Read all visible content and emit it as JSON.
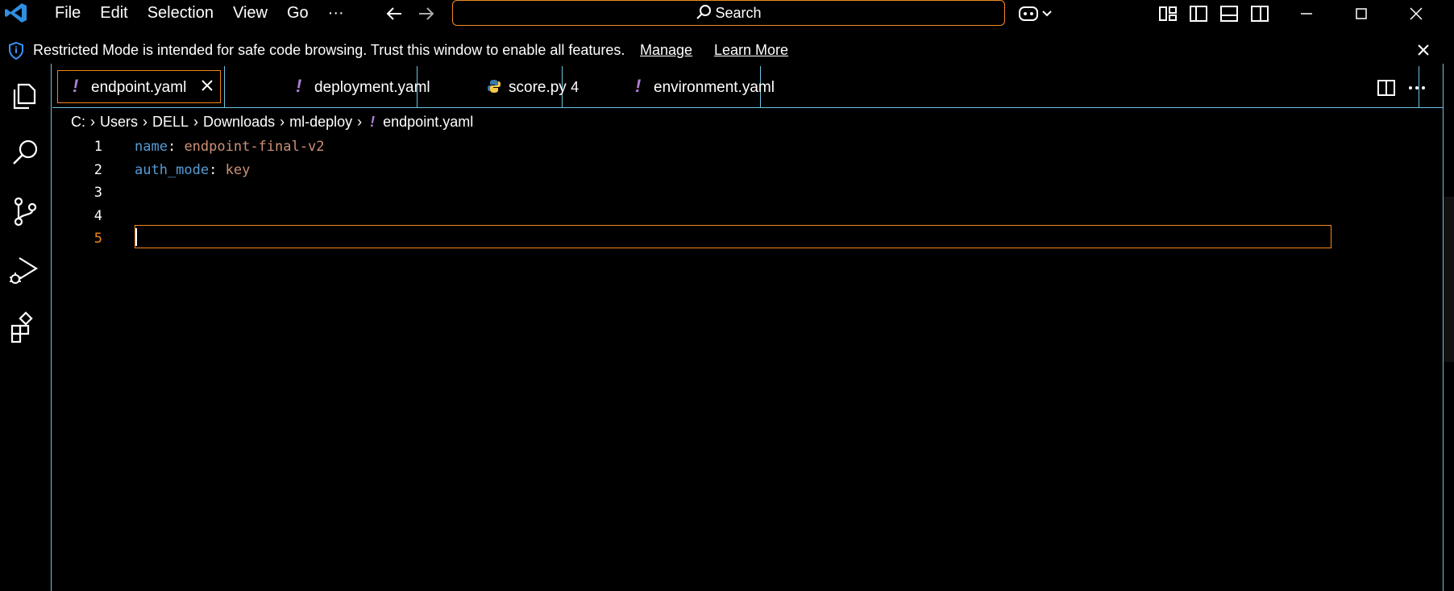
{
  "titlebar": {
    "menu": [
      "File",
      "Edit",
      "Selection",
      "View",
      "Go",
      "···"
    ],
    "search_label": "Search"
  },
  "banner": {
    "message": "Restricted Mode is intended for safe code browsing. Trust this window to enable all features.",
    "manage_label": "Manage",
    "learn_more_label": "Learn More"
  },
  "tabs": [
    {
      "icon": "!",
      "label": "endpoint.yaml",
      "active": true
    },
    {
      "icon": "!",
      "label": "deployment.yaml"
    },
    {
      "icon": "python-icon",
      "label": "score.py",
      "badge": "4"
    },
    {
      "icon": "!",
      "label": "environment.yaml"
    }
  ],
  "breadcrumb": {
    "parts": [
      "C:",
      "Users",
      "DELL",
      "Downloads",
      "ml-deploy"
    ],
    "file_icon": "!",
    "file": "endpoint.yaml"
  },
  "editor": {
    "line_numbers": [
      "1",
      "2",
      "3",
      "4",
      "5"
    ],
    "lines": [
      {
        "key": "name",
        "sep": ": ",
        "value": "endpoint-final-v2"
      },
      {
        "key": "auth_mode",
        "sep": ": ",
        "value": "key"
      }
    ],
    "current_line": "5"
  },
  "colors": {
    "accent_border": "#f38518",
    "contrast_border": "#6fc3df",
    "yaml_key": "#569cd6",
    "yaml_value": "#ce9178",
    "yaml_icon": "#b180d7"
  }
}
